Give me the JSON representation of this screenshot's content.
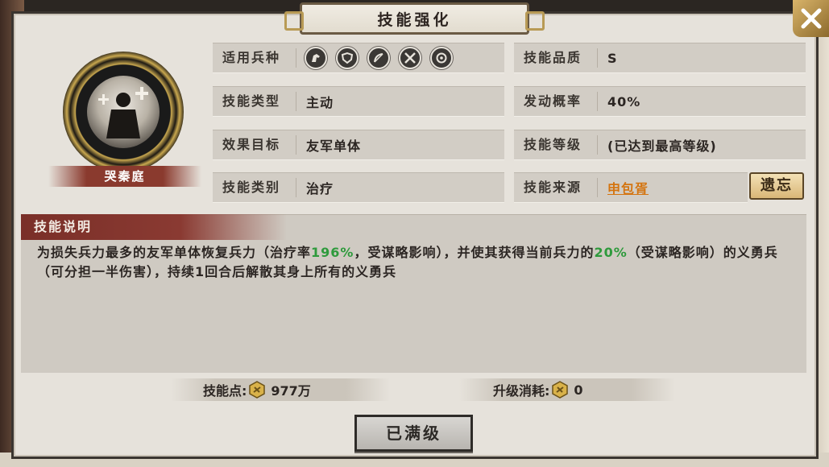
{
  "title": "技能强化",
  "general": {
    "name": "哭秦庭"
  },
  "attributes": {
    "troop_type": {
      "label": "适用兵种",
      "icons": [
        "cavalry-icon",
        "shield-icon",
        "bow-icon",
        "crossed-spears-icon",
        "wheel-icon"
      ]
    },
    "skill_type": {
      "label": "技能类型",
      "value": "主动"
    },
    "target": {
      "label": "效果目标",
      "value": "友军单体"
    },
    "category": {
      "label": "技能类别",
      "value": "治疗"
    },
    "quality": {
      "label": "技能品质",
      "value": "S"
    },
    "trigger_rate": {
      "label": "发动概率",
      "value": "40%"
    },
    "level": {
      "label": "技能等级",
      "value": "(已达到最高等级)"
    },
    "source": {
      "label": "技能来源",
      "value": "申包胥"
    }
  },
  "forget_button": "遗忘",
  "description": {
    "title": "技能说明",
    "part1": "为损失兵力最多的友军单体恢复兵力（治疗率",
    "heal_rate": "196%",
    "part2": "，受谋略影响），并使其获得当前兵力的",
    "percent": "20%",
    "part3": "（受谋略影响）的义勇兵（可分担一半伤害），持续1回合后解散其身上所有的义勇兵"
  },
  "skill_points": {
    "label": "技能点:",
    "value": "977万"
  },
  "upgrade_cost": {
    "label": "升级消耗:",
    "value": "0"
  },
  "max_button": "已满级",
  "colors": {
    "highlight": "#2e9a3c",
    "link": "#d4740f",
    "banner": "#8a3a32"
  }
}
